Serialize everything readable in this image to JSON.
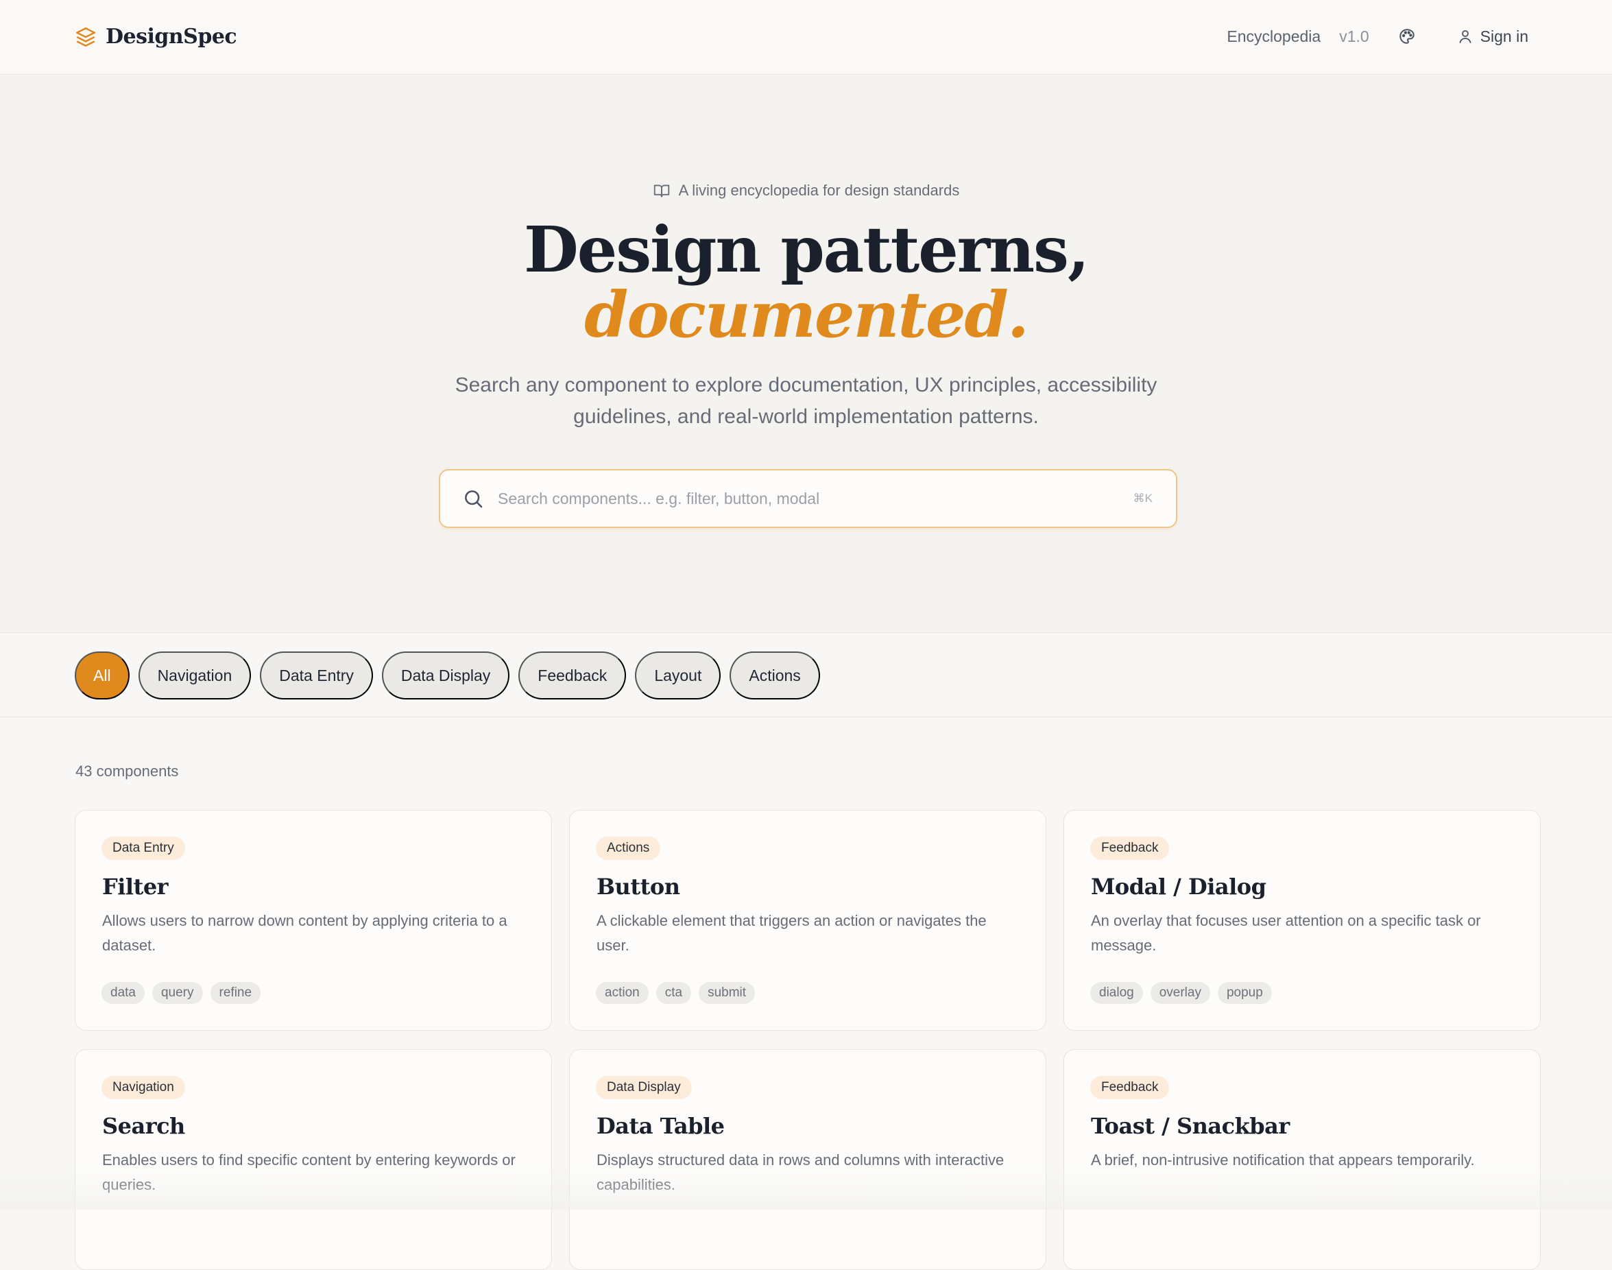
{
  "header": {
    "brand": "DesignSpec",
    "nav_link": "Encyclopedia",
    "version": "v1.0",
    "theme_icon": "palette-icon",
    "signin_label": "Sign in"
  },
  "hero": {
    "kicker": "A living encyclopedia for design standards",
    "title_line1": "Design patterns,",
    "title_line2": "documented.",
    "lede": "Search any component to explore documentation, UX principles, accessibility guidelines, and real-world implementation patterns.",
    "search_placeholder": "Search components... e.g. filter, button, modal",
    "search_value": "",
    "shortcut": "⌘K"
  },
  "filters": {
    "active": "All",
    "chips": [
      "All",
      "Navigation",
      "Data Entry",
      "Data Display",
      "Feedback",
      "Layout",
      "Actions"
    ]
  },
  "results": {
    "count_label": "43 components"
  },
  "cards": [
    {
      "category": "Data Entry",
      "title": "Filter",
      "description": "Allows users to narrow down content by applying criteria to a dataset.",
      "keywords": [
        "data",
        "query",
        "refine"
      ]
    },
    {
      "category": "Actions",
      "title": "Button",
      "description": "A clickable element that triggers an action or navigates the user.",
      "keywords": [
        "action",
        "cta",
        "submit"
      ]
    },
    {
      "category": "Feedback",
      "title": "Modal / Dialog",
      "description": "An overlay that focuses user attention on a specific task or message.",
      "keywords": [
        "dialog",
        "overlay",
        "popup"
      ]
    },
    {
      "category": "Navigation",
      "title": "Search",
      "description": "Enables users to find specific content by entering keywords or queries.",
      "keywords": []
    },
    {
      "category": "Data Display",
      "title": "Data Table",
      "description": "Displays structured data in rows and columns with interactive capabilities.",
      "keywords": []
    },
    {
      "category": "Feedback",
      "title": "Toast / Snackbar",
      "description": "A brief, non-intrusive notification that appears temporarily.",
      "keywords": []
    }
  ],
  "colors": {
    "accent": "#e08a1e",
    "heading": "#1a202c",
    "muted": "#666c77",
    "background": "#f8f7f5"
  }
}
